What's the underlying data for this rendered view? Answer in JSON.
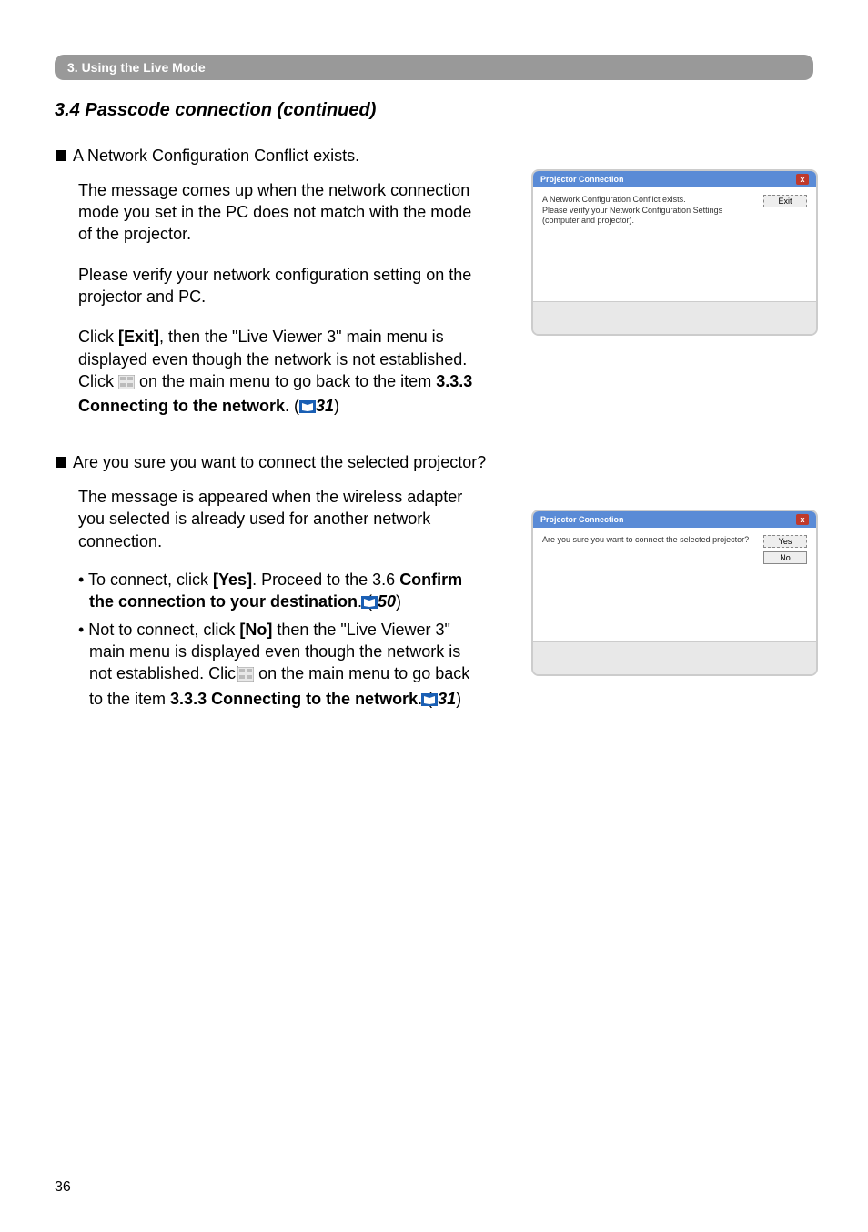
{
  "section_bar": "3. Using the Live Mode",
  "heading": "3.4 Passcode connection (continued)",
  "block1": {
    "bullet": "A Network Configuration Conflict exists.",
    "p1": "The message comes up when the network connection mode you set in the PC does not match with the mode of the projector.",
    "p2": "Please verify your network configuration setting on the projector and PC.",
    "p3a": "Click ",
    "p3b": "[Exit]",
    "p3c": ", then the \"Live Viewer 3\" main menu is displayed even though the network is not established. Click ",
    "p3d": " on the main menu to go back to the item ",
    "p3e": "3.3.3 Connecting to the network",
    "p3f": ". (",
    "p3g": "31",
    "p3h": ")"
  },
  "block2": {
    "bullet": "Are you sure you want to connect the selected projector?",
    "p1": "The message is appeared when the wireless adapter you selected is already used for another network connection.",
    "li1a": "• To connect, click ",
    "li1b": "[Yes]",
    "li1c": ". Proceed to the 3.6 ",
    "li1d": "Confirm the connection to your destination",
    "li1e": ". (",
    "li1f": "50",
    "li1g": ")",
    "li2a": "• Not to connect, click ",
    "li2b": "[No]",
    "li2c": " then the \"Live Viewer 3\" main menu is displayed even though the network is not established. Click ",
    "li2d": " on the main menu to go back to the item ",
    "li2e": "3.3.3 Connecting to the network",
    "li2f": ". (",
    "li2g": "31",
    "li2h": ")"
  },
  "dialog1": {
    "title": "Projector Connection",
    "msg": "A Network Configuration Conflict exists.\nPlease verify your Network Configuration Settings (computer and projector).",
    "btn": "Exit"
  },
  "dialog2": {
    "title": "Projector Connection",
    "msg": "Are you sure you want to connect the selected projector?",
    "btn1": "Yes",
    "btn2": "No"
  },
  "page_number": "36"
}
